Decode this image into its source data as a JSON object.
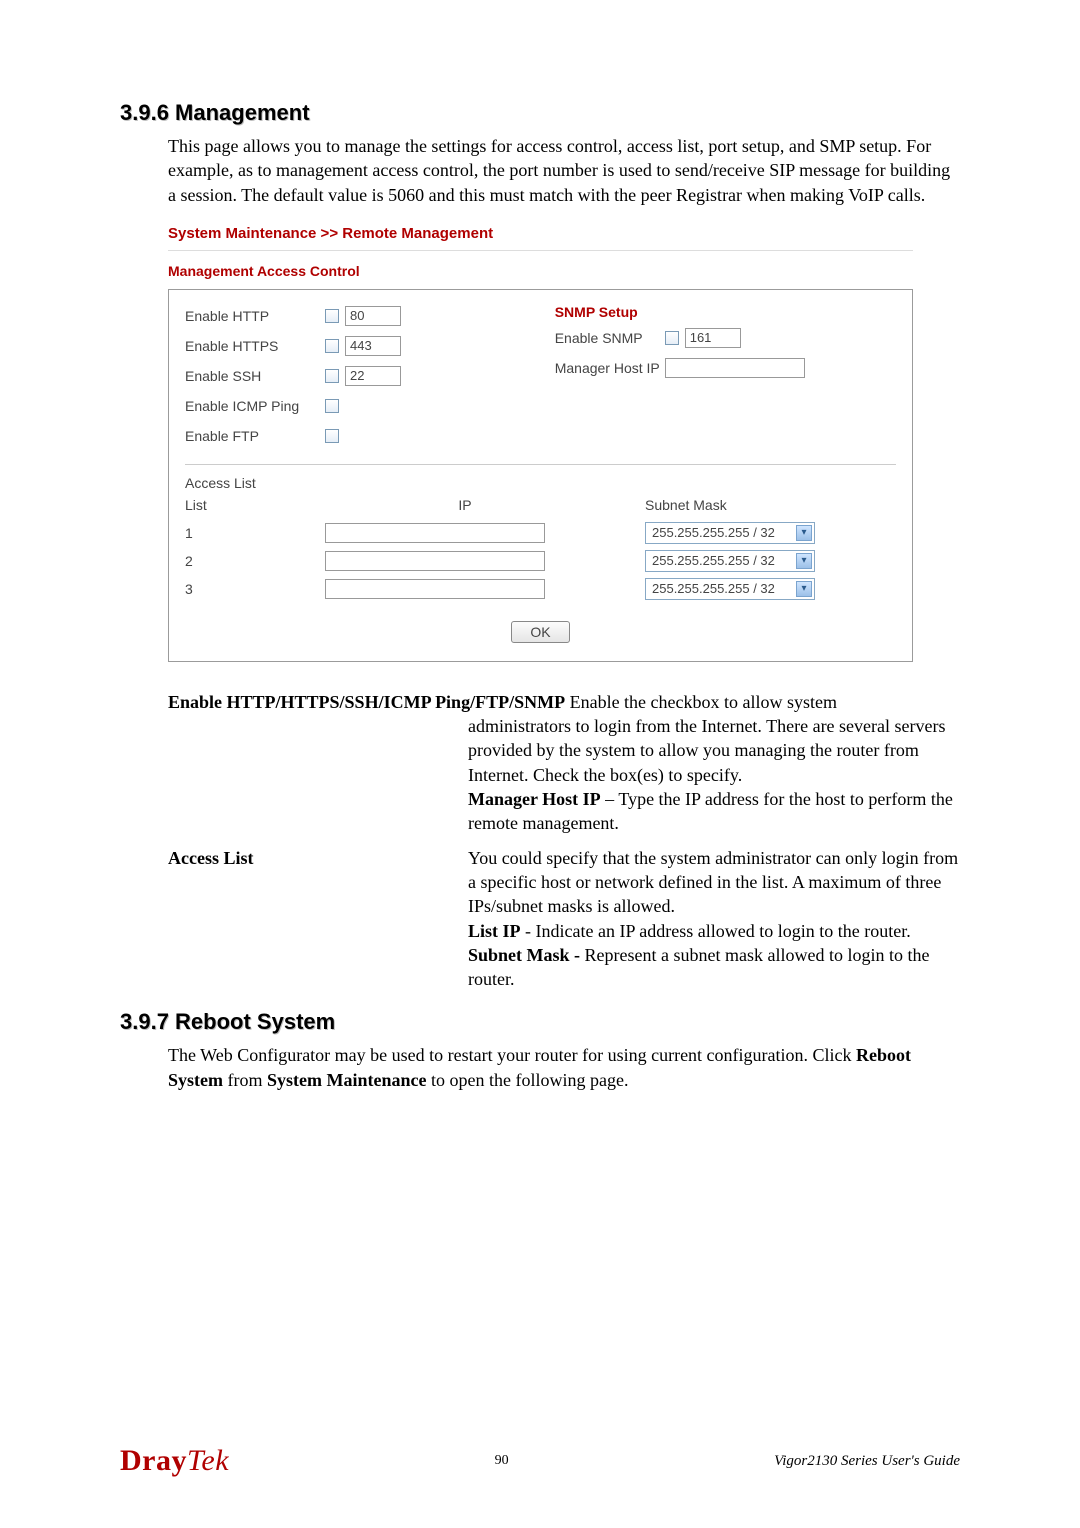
{
  "sections": {
    "management": {
      "heading": "3.9.6 Management",
      "intro": "This page allows you to manage the settings for access control, access list, port setup, and SMP setup. For example, as to management access control, the port number is used to send/receive SIP message for building a session. The default value is 5060 and this must match with the peer Registrar when making VoIP calls."
    },
    "reboot": {
      "heading": "3.9.7 Reboot System",
      "intro_prefix": "The Web Configurator may be used to restart your router for using current configuration. Click ",
      "intro_b1": "Reboot System",
      "intro_mid": " from ",
      "intro_b2": "System Maintenance",
      "intro_suffix": " to open the following page."
    }
  },
  "screenshot": {
    "breadcrumb": "System Maintenance >> Remote Management",
    "panel_title": "Management Access Control",
    "left_rows": [
      {
        "label": "Enable HTTP",
        "value": "80",
        "has_input": true
      },
      {
        "label": "Enable HTTPS",
        "value": "443",
        "has_input": true
      },
      {
        "label": "Enable SSH",
        "value": "22",
        "has_input": true
      },
      {
        "label": "Enable ICMP Ping",
        "value": "",
        "has_input": false
      },
      {
        "label": "Enable FTP",
        "value": "",
        "has_input": false
      }
    ],
    "snmp": {
      "title": "SNMP Setup",
      "enable_label": "Enable SNMP",
      "enable_value": "161",
      "manager_label": "Manager Host IP"
    },
    "access_list": {
      "section_label": "Access List",
      "list_header": "List",
      "ip_header": "IP",
      "mask_header": "Subnet Mask",
      "rows": [
        {
          "idx": "1",
          "mask": "255.255.255.255 / 32"
        },
        {
          "idx": "2",
          "mask": "255.255.255.255 / 32"
        },
        {
          "idx": "3",
          "mask": "255.255.255.255 / 32"
        }
      ]
    },
    "ok_label": "OK"
  },
  "definitions": {
    "enable_row": {
      "term": "Enable HTTP/HTTPS/SSH/ICMP Ping/FTP/SNMP",
      "lead": "  Enable the checkbox to allow system",
      "body1": "administrators to login from the Internet. There are several servers provided by the system to allow you managing the router from Internet. Check the box(es) to specify.",
      "mhip_b": "Manager Host IP",
      "mhip_t": " – Type the IP address for the host to perform the remote management."
    },
    "access_row": {
      "term": "Access List",
      "body1": "You could specify that the system administrator can only login from a specific host or network defined in the list. A maximum of three IPs/subnet masks is allowed.",
      "listip_b": "List IP",
      "listip_t": " - Indicate an IP address allowed to login to the router.",
      "subnet_b": "Subnet Mask - ",
      "subnet_t": "Represent a subnet mask allowed to login to the router."
    }
  },
  "footer": {
    "logo_dray": "Dray",
    "logo_tek": "Tek",
    "page_no": "90",
    "guide": "Vigor2130  Series  User's  Guide"
  }
}
